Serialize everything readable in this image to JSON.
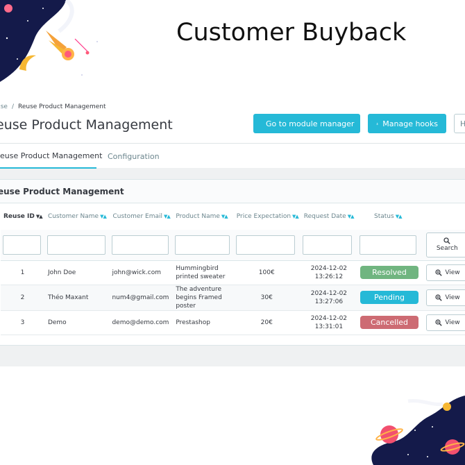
{
  "promo": {
    "title": "Customer Buyback"
  },
  "breadcrumb": {
    "parent": "use",
    "separator": "/",
    "current": "Reuse Product Management"
  },
  "page_title": "euse Product Management",
  "toolbar": {
    "module_manager": "Go to module manager",
    "manage_hooks": "Manage hooks",
    "help": "H"
  },
  "tabs": {
    "main": "euse Product Management",
    "config": "Configuration"
  },
  "card": {
    "title": "euse Product Management"
  },
  "columns": {
    "id": "Reuse ID",
    "name": "Customer Name",
    "email": "Customer Email",
    "product": "Product Name",
    "price": "Price Expectation",
    "date": "Request Date",
    "status": "Status"
  },
  "search_label": "Search",
  "view_label": "View",
  "rows": [
    {
      "id": "1",
      "name": "John Doe",
      "email": "john@wick.com",
      "product": "Hummingbird printed sweater",
      "price": "100€",
      "date": "2024-12-02",
      "time": "13:26:12",
      "status": "Resolved"
    },
    {
      "id": "2",
      "name": "Théo Maxant",
      "email": "num4@gmail.com",
      "product": "The adventure begins Framed poster",
      "price": "30€",
      "date": "2024-12-02",
      "time": "13:27:06",
      "status": "Pending"
    },
    {
      "id": "3",
      "name": "Demo",
      "email": "demo@demo.com",
      "product": "Prestashop",
      "price": "20€",
      "date": "2024-12-02",
      "time": "13:31:01",
      "status": "Cancelled"
    }
  ],
  "colors": {
    "accent": "#25b9d7",
    "resolved": "#70b580",
    "pending": "#25b9d7",
    "cancelled": "#cd6b73",
    "price": "#f5a251",
    "space": "#141a4a"
  },
  "icons": {
    "module_manager": "arrow-circle-icon",
    "manage_hooks": "anchor-icon",
    "search": "search-icon",
    "view": "zoom-in-icon"
  }
}
